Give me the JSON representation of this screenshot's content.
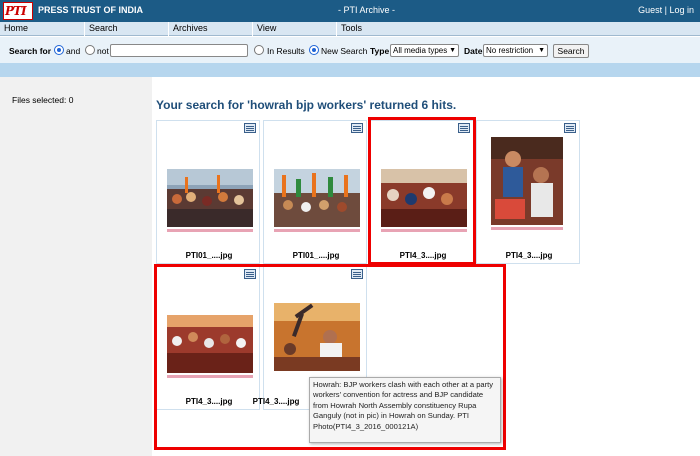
{
  "header": {
    "logo_text": "PTI",
    "org_name": "PRESS TRUST OF INDIA",
    "app_title": "- PTI Archive -",
    "guest_label": "Guest",
    "separator": "|",
    "login_label": "Log in",
    "bar_color": "#1c5b86"
  },
  "menu": [
    "Home",
    "Search",
    "Archives",
    "View",
    "Tools"
  ],
  "search": {
    "search_for_label": "Search for",
    "and_label": "and",
    "not_label": "not",
    "query_value": "",
    "in_results_label": "In Results",
    "new_search_label": "New Search",
    "type_label": "Type",
    "type_value": "All media types",
    "date_label": "Date",
    "date_value": "No restriction",
    "search_button": "Search",
    "and_selected": true,
    "new_search_selected": true
  },
  "sidebar": {
    "files_selected": "Files selected: 0"
  },
  "results": {
    "title": "Your search for 'howrah bjp workers' returned 6 hits.",
    "items": [
      {
        "name": "PTI01_....jpg"
      },
      {
        "name": "PTI01_....jpg"
      },
      {
        "name": "PTI4_3....jpg"
      },
      {
        "name": "PTI4_3....jpg"
      },
      {
        "name": "PTI4_3....jpg"
      },
      {
        "name": "PTI4_3....jpg"
      }
    ],
    "tooltip": "Howrah: BJP workers clash with each other at a party workers' convention for actress and BJP candidate from Howrah North Assembly constituency Rupa Ganguly (not in pic) in Howrah on  Sunday. PTI Photo(PTI4_3_2016_000121A)"
  },
  "colors": {
    "highlight": "#e00000",
    "title_text": "#1f4e79",
    "strip": "#b6d6ee"
  }
}
